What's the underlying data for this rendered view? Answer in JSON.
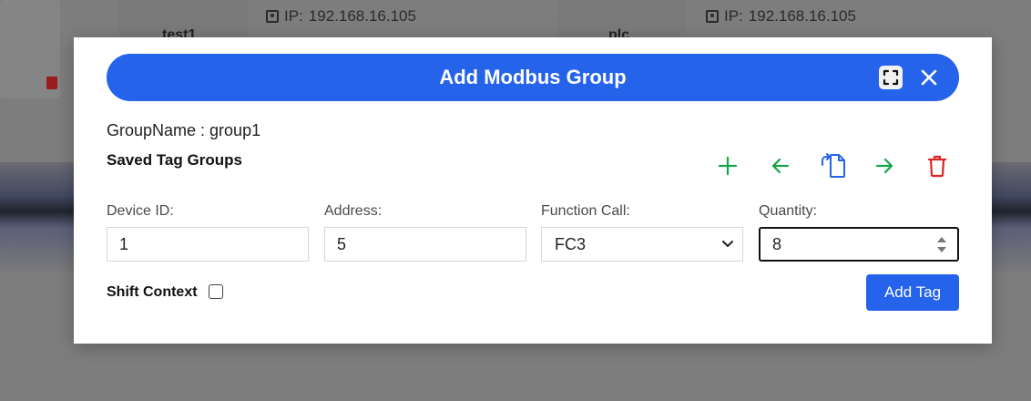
{
  "background": {
    "cards": [
      {
        "name": "test1",
        "ip_label": "IP:",
        "ip": "192.168.16.105"
      },
      {
        "name": "plc",
        "ip_label": "IP:",
        "ip": "192.168.16.105"
      }
    ]
  },
  "modal": {
    "title": "Add Modbus Group",
    "group_name": "GroupName : group1",
    "saved_groups_title": "Saved Tag Groups",
    "fields": {
      "device_id": {
        "label": "Device ID:",
        "value": "1"
      },
      "address": {
        "label": "Address:",
        "value": "5"
      },
      "function_call": {
        "label": "Function Call:",
        "value": "FC3"
      },
      "quantity": {
        "label": "Quantity:",
        "value": "8"
      }
    },
    "shift_context_label": "Shift Context",
    "shift_context_checked": false,
    "add_tag_label": "Add Tag"
  },
  "colors": {
    "primary": "#2563eb",
    "green": "#16a34a",
    "red": "#dc2626",
    "overlay": "#7d7d7d"
  },
  "icons": {
    "toolbar": [
      "plus-icon",
      "arrow-left-icon",
      "copy-document-icon",
      "arrow-right-icon",
      "trash-icon"
    ],
    "header": [
      "expand-icon",
      "close-icon"
    ]
  }
}
